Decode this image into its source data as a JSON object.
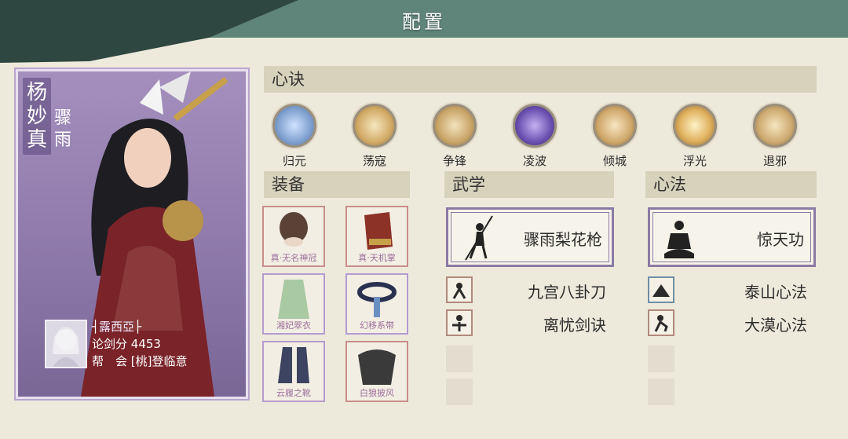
{
  "header": {
    "title": "配置"
  },
  "character": {
    "name_v": "杨\n妙\n真",
    "title_v": "骤\n雨",
    "player": "露西亞",
    "score_label": "论剑分",
    "score": "4453",
    "guild_label": "帮　会",
    "guild": "[桃]登临意"
  },
  "sections": {
    "xinjue": "心诀",
    "zhuangbei": "装备",
    "wuxue": "武学",
    "xinfa": "心法"
  },
  "skills": [
    {
      "label": "归元",
      "icon": "meditation-icon",
      "color": "#8fb3de"
    },
    {
      "label": "荡寇",
      "icon": "swirl-icon",
      "color": "#e3c78e"
    },
    {
      "label": "争锋",
      "icon": "fist-icon",
      "color": "#d8c091"
    },
    {
      "label": "凌波",
      "icon": "dash-icon",
      "color": "#7e63b8"
    },
    {
      "label": "倾城",
      "icon": "maiden-icon",
      "color": "#e0c590"
    },
    {
      "label": "浮光",
      "icon": "light-icon",
      "color": "#e8c77f"
    },
    {
      "label": "退邪",
      "icon": "gate-icon",
      "color": "#dbc58e"
    }
  ],
  "equipment": [
    {
      "label": "真·无名神冠",
      "icon": "crown-icon"
    },
    {
      "label": "真·天机掌",
      "icon": "gauntlet-icon"
    },
    {
      "label": "湘妃翠衣",
      "icon": "robe-icon"
    },
    {
      "label": "幻移系带",
      "icon": "belt-icon"
    },
    {
      "label": "云履之靴",
      "icon": "boots-icon"
    },
    {
      "label": "白狼披风",
      "icon": "cloak-icon"
    }
  ],
  "wuxue": {
    "main": "骤雨梨花枪",
    "others": [
      "九宫八卦刀",
      "离忧剑诀"
    ]
  },
  "xinfa": {
    "main": "惊天功",
    "others": [
      "泰山心法",
      "大漠心法"
    ]
  }
}
